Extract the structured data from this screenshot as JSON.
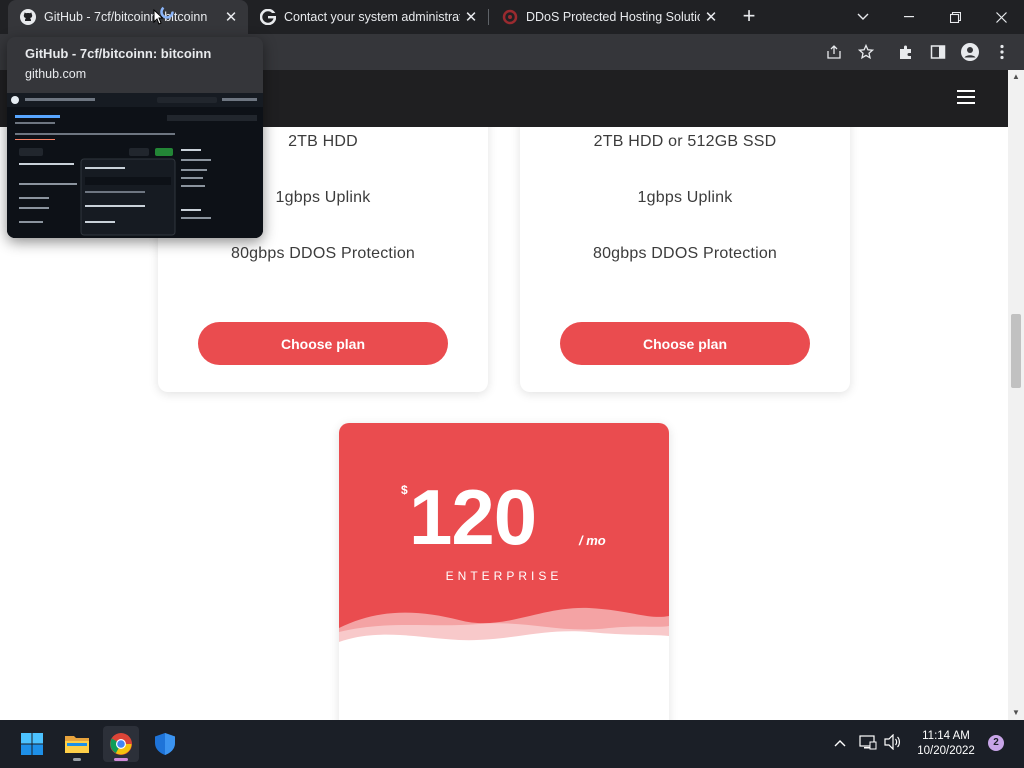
{
  "browser": {
    "tabs": [
      {
        "title": "GitHub - 7cf/bitcoinn: bitcoinn",
        "icon": "github-icon"
      },
      {
        "title": "Contact your system administrator",
        "icon": "google-icon"
      },
      {
        "title": "DDoS Protected Hosting Solutions",
        "icon": "ddos-site-icon"
      }
    ],
    "new_tab_label": "+",
    "hover_card": {
      "title": "GitHub - 7cf/bitcoinn: bitcoinn",
      "url": "github.com"
    }
  },
  "page": {
    "plans": [
      {
        "features": [
          "2TB HDD",
          "1gbps Uplink",
          "80gbps DDOS Protection"
        ],
        "button_label": "Choose plan"
      },
      {
        "features": [
          "2TB HDD or 512GB SSD",
          "1gbps Uplink",
          "80gbps DDOS Protection"
        ],
        "button_label": "Choose plan"
      }
    ],
    "enterprise": {
      "currency": "$",
      "price": "120",
      "period": "/ mo",
      "name": "ENTERPRISE"
    },
    "accent_color": "#ea4c4f"
  },
  "taskbar": {
    "time": "11:14 AM",
    "date": "10/20/2022",
    "notification_count": "2",
    "apps": [
      "windows-start-icon",
      "file-explorer-icon",
      "chrome-icon",
      "windows-security-icon"
    ]
  }
}
